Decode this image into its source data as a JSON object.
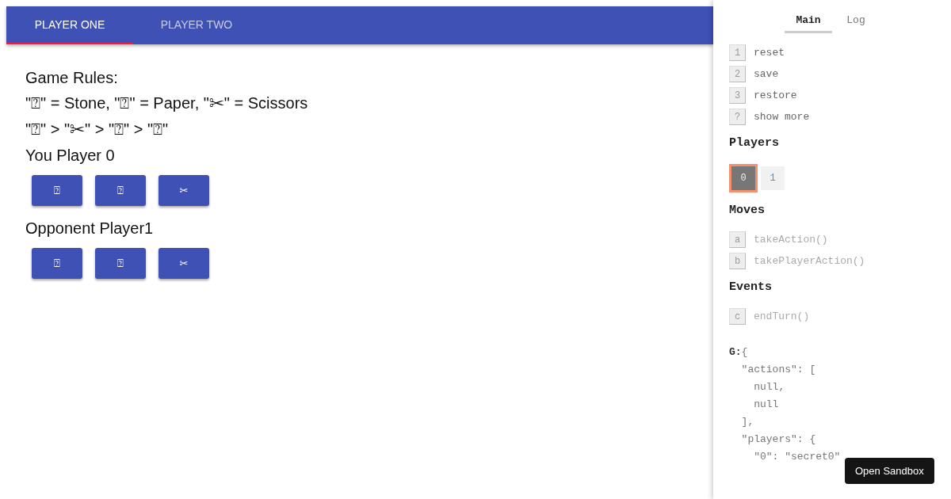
{
  "tabs": [
    {
      "label": "PLAYER ONE",
      "selected": true
    },
    {
      "label": "PLAYER TWO",
      "selected": false
    }
  ],
  "rules": {
    "heading": "Game Rules:",
    "legend": "\"⍰\" = Stone, \"⍰\" = Paper, \"✂\" = Scissors",
    "order": "\"⍰\" > \"✂\" > \"⍰\" > \"⍰\""
  },
  "players": [
    {
      "label": "You Player 0",
      "buttons": [
        "⍰",
        "⍰",
        "✂"
      ]
    },
    {
      "label": "Opponent Player1",
      "buttons": [
        "⍰",
        "⍰",
        "✂"
      ]
    }
  ],
  "debug": {
    "tabs": [
      {
        "label": "Main",
        "selected": true
      },
      {
        "label": "Log",
        "selected": false
      }
    ],
    "controls": [
      {
        "key": "1",
        "label": "reset"
      },
      {
        "key": "2",
        "label": "save"
      },
      {
        "key": "3",
        "label": "restore"
      },
      {
        "key": "?",
        "label": "show more"
      }
    ],
    "players_heading": "Players",
    "players": [
      {
        "label": "0",
        "selected": true
      },
      {
        "label": "1",
        "selected": false
      }
    ],
    "moves_heading": "Moves",
    "moves": [
      {
        "key": "a",
        "label": "takeAction()"
      },
      {
        "key": "b",
        "label": "takePlayerAction()"
      }
    ],
    "events_heading": "Events",
    "events": [
      {
        "key": "c",
        "label": "endTurn()"
      }
    ],
    "state_key": "G:",
    "state_lines": [
      "{",
      "  \"actions\": [",
      "    null,",
      "    null",
      "  ],",
      "  \"players\": {",
      "    \"0\": \"secret0\""
    ]
  },
  "sandbox_button": "Open Sandbox"
}
